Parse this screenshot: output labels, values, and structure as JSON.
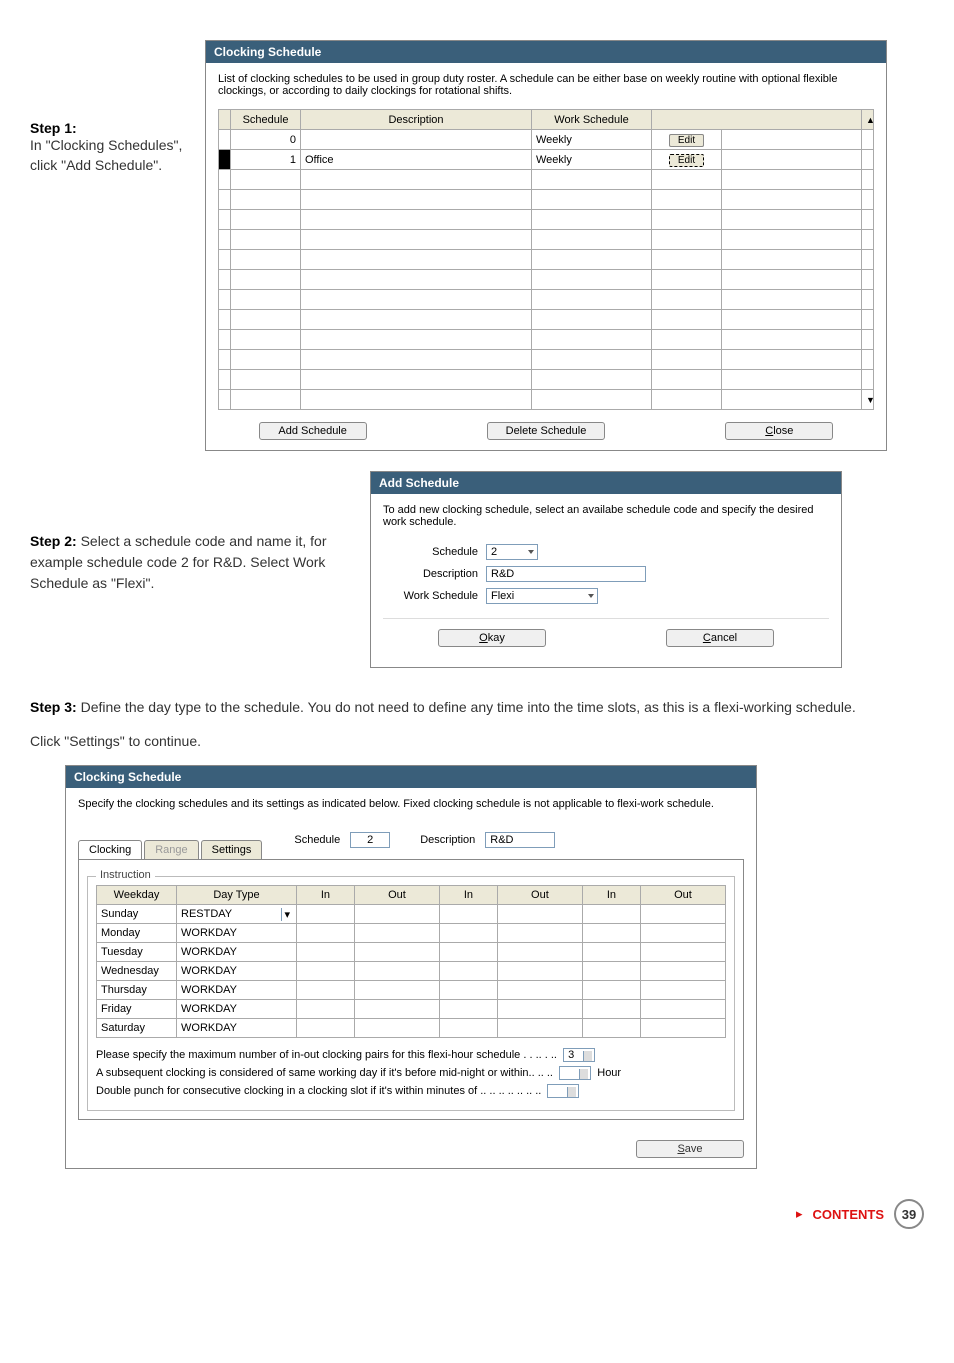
{
  "step1": {
    "title": "Step 1:",
    "text": "In \"Clocking Schedules\", click \"Add Schedule\"."
  },
  "clockingDialog": {
    "title": "Clocking Schedule",
    "intro": "List of clocking schedules to be used in group duty roster. A schedule can be either base on weekly routine with optional flexible clockings, or according to daily clockings for rotational shifts.",
    "headers": {
      "schedule": "Schedule",
      "description": "Description",
      "workSchedule": "Work Schedule"
    },
    "rows": [
      {
        "schedule": "0",
        "description": "",
        "workSchedule": "Weekly",
        "btn": "Edit"
      },
      {
        "schedule": "1",
        "description": "Office",
        "workSchedule": "Weekly",
        "btn": "Edit"
      }
    ],
    "addBtn": "Add Schedule",
    "deleteBtn": "Delete Schedule",
    "closeBtn": "Close"
  },
  "step2": {
    "title": "Step 2:",
    "text": " Select a schedule code and name it, for example schedule code 2 for R&D. Select Work Schedule as \"Flexi\"."
  },
  "addDialog": {
    "title": "Add Schedule",
    "intro": "To add new clocking schedule, select an availabe schedule code and specify the desired work schedule.",
    "labels": {
      "schedule": "Schedule",
      "description": "Description",
      "workSchedule": "Work Schedule"
    },
    "values": {
      "schedule": "2",
      "description": "R&D",
      "workSchedule": "Flexi"
    },
    "okay": "Okay",
    "cancel": "Cancel"
  },
  "step3": {
    "title": "Step 3:",
    "text": " Define the day type to the schedule. You do not need to define any time into the time slots, as this is a flexi-working schedule.",
    "click": "Click \"Settings\" to continue."
  },
  "clock3": {
    "title": "Clocking Schedule",
    "intro": "Specify the clocking schedules and its settings as indicated below. Fixed clocking schedule is not applicable to flexi-work schedule.",
    "tabs": {
      "clocking": "Clocking",
      "range": "Range",
      "settings": "Settings"
    },
    "scheduleLabel": "Schedule",
    "scheduleVal": "2",
    "descLabel": "Description",
    "descVal": "R&D",
    "legend": "Instruction",
    "headers": [
      "Weekday",
      "Day Type",
      "In",
      "Out",
      "In",
      "Out",
      "In",
      "Out"
    ],
    "days": [
      {
        "weekday": "Sunday",
        "type": "RESTDAY"
      },
      {
        "weekday": "Monday",
        "type": "WORKDAY"
      },
      {
        "weekday": "Tuesday",
        "type": "WORKDAY"
      },
      {
        "weekday": "Wednesday",
        "type": "WORKDAY"
      },
      {
        "weekday": "Thursday",
        "type": "WORKDAY"
      },
      {
        "weekday": "Friday",
        "type": "WORKDAY"
      },
      {
        "weekday": "Saturday",
        "type": "WORKDAY"
      }
    ],
    "notes": {
      "n1": "Please specify the maximum number of in-out clocking pairs for this flexi-hour schedule . . .. . ..",
      "n1val": "3",
      "n2": "A subsequent clocking is considered of same working day if it's before mid-night or within.. .. ..",
      "n2unit": "Hour",
      "n3": "Double punch for consecutive clocking in a clocking slot if it's within minutes of  .. .. .. .. .. .. .."
    },
    "save": "Save"
  },
  "footer": {
    "contents": "CONTENTS",
    "page": "39"
  }
}
